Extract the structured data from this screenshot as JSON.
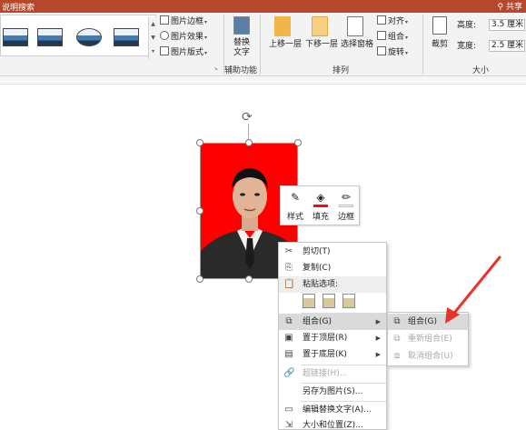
{
  "window": {
    "title_left": "说明搜索",
    "title_right": "共享"
  },
  "ribbon": {
    "picture_border": "图片边框",
    "picture_effects": "图片效果",
    "picture_layout": "图片版式",
    "alt_text": "替换\n文字",
    "accessibility_group": "辅助功能",
    "bring_forward": "上移一层",
    "send_backward": "下移一层",
    "selection_pane": "选择窗格",
    "align": "对齐",
    "group": "组合",
    "rotate": "旋转",
    "arrange_group": "排列",
    "crop": "裁剪",
    "height_label": "高度:",
    "height_value": "3.5 厘米",
    "width_label": "宽度:",
    "width_value": "2.5 厘米",
    "size_group": "大小"
  },
  "minibar": {
    "style": "样式",
    "fill": "填充",
    "outline": "边框"
  },
  "context_menu": {
    "cut": "剪切(T)",
    "copy": "复制(C)",
    "paste_options": "粘贴选项:",
    "group": "组合(G)",
    "bring_to_front": "置于顶层(R)",
    "send_to_back": "置于底层(K)",
    "link": "超链接(H)...",
    "save_as_picture": "另存为图片(S)...",
    "edit_alt_text": "编辑替换文字(A)...",
    "size_position": "大小和位置(Z)..."
  },
  "submenu": {
    "group": "组合(G)",
    "regroup": "重新组合(E)",
    "ungroup": "取消组合(U)"
  },
  "colors": {
    "accent": "#b7472a",
    "photo_bg": "#ff0000",
    "arrow": "#e8332a"
  }
}
